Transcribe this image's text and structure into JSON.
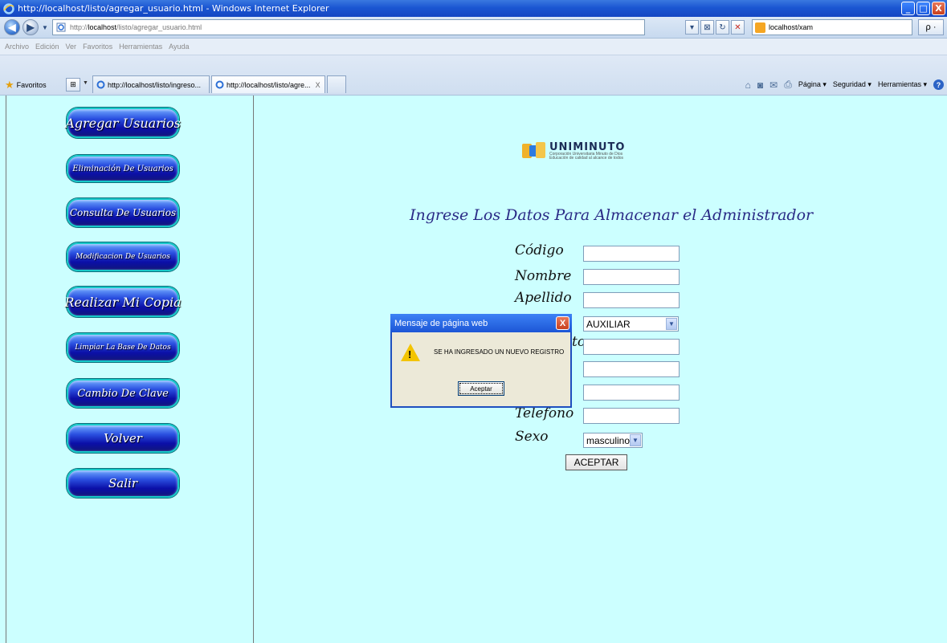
{
  "window": {
    "title": "http://localhost/listo/agregar_usuario.html - Windows Internet Explorer",
    "minimize_glyph": "_",
    "restore_glyph": "□",
    "close_glyph": "X"
  },
  "address_bar": {
    "url_prefix": "http://",
    "url_host": "localhost",
    "url_path": "/listo/agregar_usuario.html",
    "search_value": "localhost/xam",
    "search_go": "ρ ·"
  },
  "menu": [
    "Archivo",
    "Edición",
    "Ver",
    "Favoritos",
    "Herramientas",
    "Ayuda"
  ],
  "favorites_bar": {
    "favorites_label": "Favoritos",
    "tabs": [
      {
        "label": "http://localhost/listo/ingreso..."
      },
      {
        "label": "http://localhost/listo/agre...",
        "close": "X"
      }
    ],
    "commands": [
      "Página ▾",
      "Seguridad ▾",
      "Herramientas ▾"
    ]
  },
  "sidebar": {
    "buttons": [
      {
        "label": "Agregar Usuarios"
      },
      {
        "label": "Eliminación De Usuarios"
      },
      {
        "label": "Consulta De Usuarios"
      },
      {
        "label": "Modificacion De Usuarios"
      },
      {
        "label": "Realizar Mi Copia"
      },
      {
        "label": "Limpiar La Base De Datos"
      },
      {
        "label": "Cambio De Clave"
      },
      {
        "label": "Volver"
      },
      {
        "label": "Salir"
      }
    ]
  },
  "logo": {
    "brand": "UNIMINUTO",
    "line1": "Corporación Universitaria Minuto de Dios",
    "line2": "Educación de calidad al alcance de todos"
  },
  "form": {
    "title": "Ingrese Los Datos Para Almacenar el Administrador",
    "labels": {
      "codigo": "Código",
      "nombre": "Nombre",
      "apellido": "Apellido",
      "partial": "to",
      "telefono": "Telefono",
      "sexo": "Sexo"
    },
    "cargo_value": "AUXILIAR",
    "sexo_value": "masculino",
    "submit": "ACEPTAR"
  },
  "dialog": {
    "title": "Mensaje de página web",
    "message": "SE HA INGRESADO UN NUEVO REGISTRO",
    "ok": "Aceptar",
    "close": "X",
    "warning_glyph": "!"
  },
  "colors": {
    "page_background": "#ccffff",
    "titlebar": "#1b56d2",
    "form_title": "#2a2a86"
  }
}
